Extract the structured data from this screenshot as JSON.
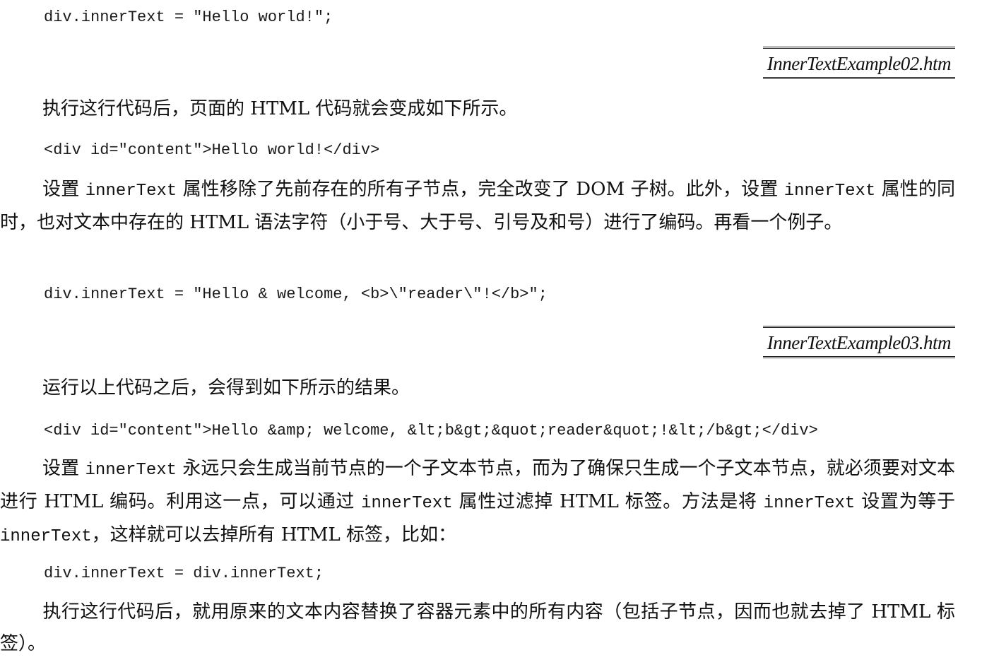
{
  "code1": "div.innerText = \"Hello world!\";",
  "filename1": "InnerTextExample02.htm",
  "para1": "执行这行代码后，页面的 HTML 代码就会变成如下所示。",
  "code2": "<div id=\"content\">Hello world!</div>",
  "para2": {
    "t1": "设置 ",
    "c1": "innerText",
    "t2": " 属性移除了先前存在的所有子节点，完全改变了 DOM 子树。此外，设置 ",
    "c2": "innerText",
    "t3": " 属性的同时，也对文本中存在的 HTML 语法字符（小于号、大于号、引号及和号）进行了编码。再看一个例子。"
  },
  "code3": "div.innerText = \"Hello & welcome, <b>\\\"reader\\\"!</b>\";",
  "filename2": "InnerTextExample03.htm",
  "para3": "运行以上代码之后，会得到如下所示的结果。",
  "code4": "<div id=\"content\">Hello &amp; welcome, &lt;b&gt;&quot;reader&quot;!&lt;/b&gt;</div>",
  "para4": {
    "t1": "设置 ",
    "c1": "innerText",
    "t2": " 永远只会生成当前节点的一个子文本节点，而为了确保只生成一个子文本节点，就必须要对文本进行 HTML 编码。利用这一点，可以通过 ",
    "c2": "innerText",
    "t3": " 属性过滤掉 HTML 标签。方法是将 ",
    "c3": "innerText",
    "t4": " 设置为等于 ",
    "c4": "innerText",
    "t5": "，这样就可以去掉所有 HTML 标签，比如："
  },
  "code5": "div.innerText = div.innerText;",
  "para5": "执行这行代码后，就用原来的文本内容替换了容器元素中的所有内容（包括子节点，因而也就去掉了 HTML 标签）。"
}
